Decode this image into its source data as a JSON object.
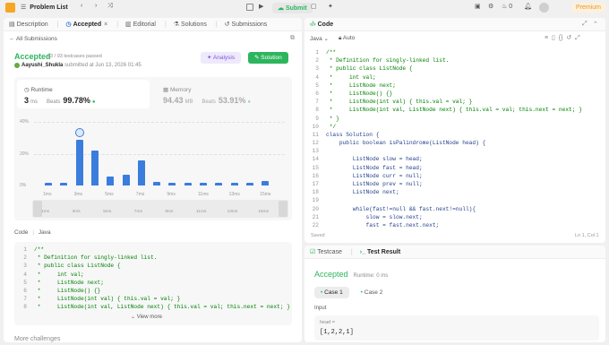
{
  "topbar": {
    "problem_list": "Problem List",
    "submit": "Submit",
    "notif_count": "0",
    "premium": "Premium"
  },
  "left": {
    "tabs": [
      "Description",
      "Accepted",
      "Editorial",
      "Solutions",
      "Submissions"
    ],
    "all_submissions": "All Submissions",
    "status": "Accepted",
    "testcases": "93 / 93 testcases passed",
    "user": "Aayushi_Shukla",
    "submitted_at": "submitted at Jun 13, 2026 01:45",
    "analysis": "Analysis",
    "solution": "Solution",
    "runtime_label": "Runtime",
    "runtime_value": "3",
    "runtime_unit": "ms",
    "beats_label": "Beats",
    "runtime_beats": "99.78%",
    "memory_label": "Memory",
    "memory_value": "94.43",
    "memory_unit": "MB",
    "memory_beats": "53.91%",
    "y_ticks": [
      "40%",
      "20%",
      "0%"
    ],
    "x_ticks": [
      "1ms",
      "3ms",
      "5ms",
      "7ms",
      "9ms",
      "11ms",
      "13ms",
      "15ms"
    ],
    "mini_ticks": [
      "1ms",
      "3ms",
      "5ms",
      "7ms",
      "9ms",
      "11ms",
      "13ms",
      "15ms"
    ],
    "code_label": "Code",
    "code_lang": "Java",
    "code_lines": [
      "/**",
      " * Definition for singly-linked list.",
      " * public class ListNode {",
      " *     int val;",
      " *     ListNode next;",
      " *     ListNode() {}",
      " *     ListNode(int val) { this.val = val; }",
      " *     ListNode(int val, ListNode next) { this.val = val; this.next = next; }"
    ],
    "view_more": "View more",
    "more_challenges": "More challenges"
  },
  "chart_data": {
    "type": "bar",
    "x": [
      1,
      2,
      3,
      4,
      5,
      6,
      7,
      8,
      9,
      10,
      11,
      12,
      13,
      14,
      15
    ],
    "values": [
      1.5,
      1.5,
      29,
      22,
      5.5,
      6.5,
      16,
      2.5,
      1.5,
      1.5,
      1.5,
      1.5,
      1.5,
      1.5,
      3
    ],
    "yticks": [
      "40%",
      "20%",
      "0%"
    ],
    "ylim": [
      0,
      40
    ],
    "highlight_index": 2
  },
  "editor": {
    "title": "Code",
    "lang": "Java",
    "auto": "Auto",
    "saved": "Saved",
    "position": "Ln 1, Col 1",
    "lines": [
      "/**",
      " * Definition for singly-linked list.",
      " * public class ListNode {",
      " *     int val;",
      " *     ListNode next;",
      " *     ListNode() {}",
      " *     ListNode(int val) { this.val = val; }",
      " *     ListNode(int val, ListNode next) { this.val = val; this.next = next; }",
      " * }",
      " */",
      "class Solution {",
      "    public boolean isPalindrome(ListNode head) {",
      "",
      "        ListNode slow = head;",
      "        ListNode fast = head;",
      "        ListNode curr = null;",
      "        ListNode prev = null;",
      "        ListNode next;",
      "",
      "        while(fast!=null && fast.next!=null){",
      "            slow = slow.next;",
      "            fast = fast.next.next;"
    ]
  },
  "test": {
    "testcase_tab": "Testcase",
    "result_tab": "Test Result",
    "status": "Accepted",
    "runtime": "Runtime: 0 ms",
    "case1": "Case 1",
    "case2": "Case 2",
    "input_label": "Input",
    "var_name": "head =",
    "var_value": "[1,2,2,1]"
  }
}
